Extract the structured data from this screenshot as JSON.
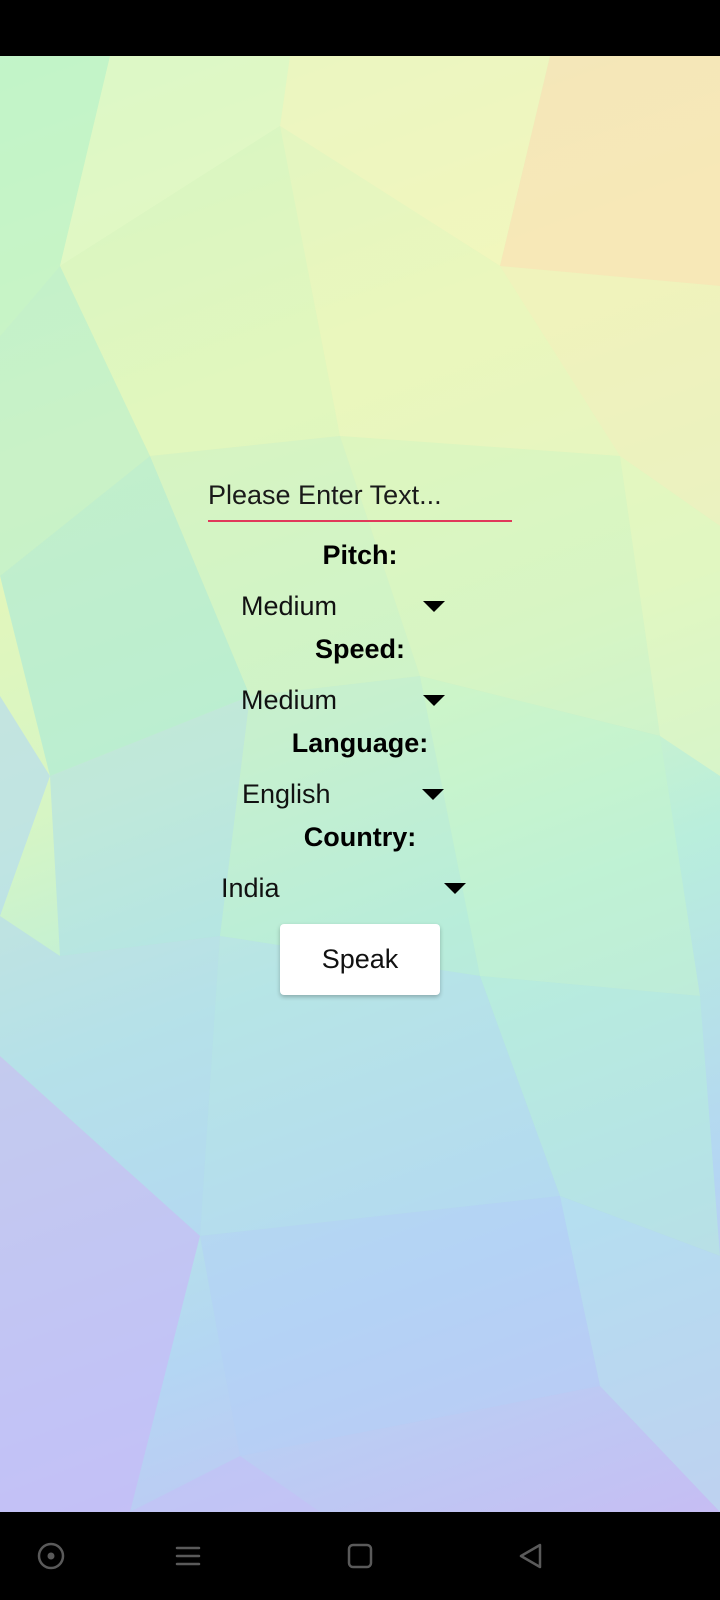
{
  "input": {
    "placeholder": "Please Enter Text...",
    "value": ""
  },
  "pitch": {
    "label": "Pitch:",
    "value": "Medium"
  },
  "speed": {
    "label": "Speed:",
    "value": "Medium"
  },
  "language": {
    "label": "Language:",
    "value": "English"
  },
  "country": {
    "label": "Country:",
    "value": "India"
  },
  "speak_button": "Speak",
  "nav": {
    "icons": [
      "target-circle-icon",
      "menu-icon",
      "home-square-icon",
      "back-triangle-icon"
    ]
  },
  "colors": {
    "input_underline": "#e0385a",
    "button_bg": "#ffffff",
    "bars": "#000000"
  }
}
